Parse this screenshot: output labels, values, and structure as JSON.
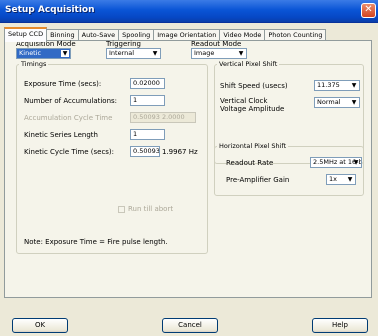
{
  "window": {
    "title": "Setup Acquisition"
  },
  "tabs": [
    {
      "label": "Setup CCD"
    },
    {
      "label": "Binning"
    },
    {
      "label": "Auto-Save"
    },
    {
      "label": "Spooling"
    },
    {
      "label": "Image Orientation"
    },
    {
      "label": "Video Mode"
    },
    {
      "label": "Photon Counting"
    }
  ],
  "modes": {
    "acquisition_label": "Acquisition Mode",
    "acquisition_value": "Kinetic",
    "triggering_label": "Triggering",
    "triggering_value": "Internal",
    "readout_label": "Readout Mode",
    "readout_value": "Image"
  },
  "timings": {
    "title": "Timings",
    "exposure_label": "Exposure Time (secs):",
    "exposure_value": "0.02000",
    "accumulations_label": "Number of Accumulations:",
    "accumulations_value": "1",
    "accum_cycle_label": "Accumulation Cycle Time",
    "accum_cycle_value": "0.50093 2.0000",
    "kinetic_length_label": "Kinetic Series Length",
    "kinetic_length_value": "1",
    "kinetic_cycle_label": "Kinetic Cycle Time (secs):",
    "kinetic_cycle_value": "0.50093",
    "kinetic_cycle_hz": "1.9967 Hz",
    "run_till_abort_label": "Run till abort",
    "note": "Note: Exposure Time = Fire pulse length."
  },
  "vertical_shift": {
    "title": "Vertical Pixel Shift",
    "speed_label": "Shift Speed (usecs)",
    "speed_value": "11.375",
    "clock_label_line1": "Vertical Clock",
    "clock_label_line2": "Voltage Amplitude",
    "clock_value": "Normal"
  },
  "horizontal_shift": {
    "title": "Horizontal Pixel Shift",
    "readout_rate_label": "Readout Rate",
    "readout_rate_value": "2.5MHz at 16-bit",
    "preamp_label": "Pre-Amplifier Gain",
    "preamp_value": "1x"
  },
  "buttons": {
    "ok": "OK",
    "cancel": "Cancel",
    "help": "Help"
  }
}
